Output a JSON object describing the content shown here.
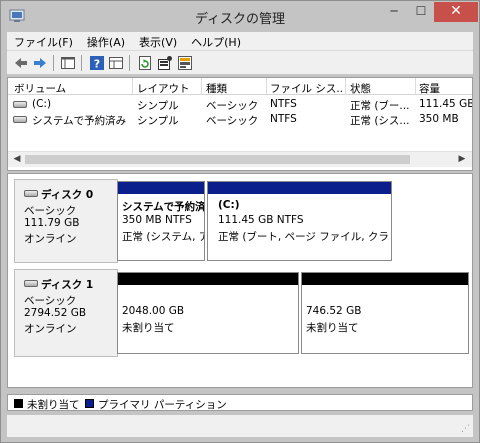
{
  "window": {
    "title": "ディスクの管理",
    "close": "✕",
    "minimize": "─",
    "maximize": "☐"
  },
  "menu": [
    {
      "label": "ファイル(F)"
    },
    {
      "label": "操作(A)"
    },
    {
      "label": "表示(V)"
    },
    {
      "label": "ヘルプ(H)"
    }
  ],
  "toolbar": {
    "icons": [
      "back-arrow-icon",
      "forward-arrow-icon",
      "console-tree-icon",
      "help-icon",
      "properties-icon",
      "refresh-icon",
      "settings-icon",
      "disk-list-icon"
    ]
  },
  "volumes": {
    "columns": [
      "ボリューム",
      "レイアウト",
      "種類",
      "ファイル シス...",
      "状態",
      "容量"
    ],
    "rows": [
      {
        "volume": "(C:)",
        "layout": "シンプル",
        "type": "ベーシック",
        "fs": "NTFS",
        "status": "正常 (ブー...",
        "capacity": "111.45 GB"
      },
      {
        "volume": "システムで予約済み",
        "layout": "シンプル",
        "type": "ベーシック",
        "fs": "NTFS",
        "status": "正常 (シス...",
        "capacity": "350 MB"
      }
    ]
  },
  "disks": [
    {
      "name": "ディスク 0",
      "kind": "ベーシック",
      "size": "111.79 GB",
      "state": "オンライン",
      "partitions": [
        {
          "title": "システムで予約済",
          "size": "350 MB NTFS",
          "status": "正常 (システム, ア"
        },
        {
          "title": "(C:)",
          "size": "111.45 GB NTFS",
          "status": "正常 (ブート, ページ ファイル, クラッシュ"
        }
      ]
    },
    {
      "name": "ディスク 1",
      "kind": "ベーシック",
      "size": "2794.52 GB",
      "state": "オンライン",
      "partitions": [
        {
          "size": "2048.00 GB",
          "status": "未割り当て"
        },
        {
          "size": "746.52 GB",
          "status": "未割り当て"
        }
      ]
    }
  ],
  "legend": {
    "unallocated": "未割り当て",
    "primary": "プライマリ パーティション"
  },
  "colors": {
    "primary": "#0a1e8c",
    "unallocated": "#000000",
    "close": "#c7504b"
  }
}
